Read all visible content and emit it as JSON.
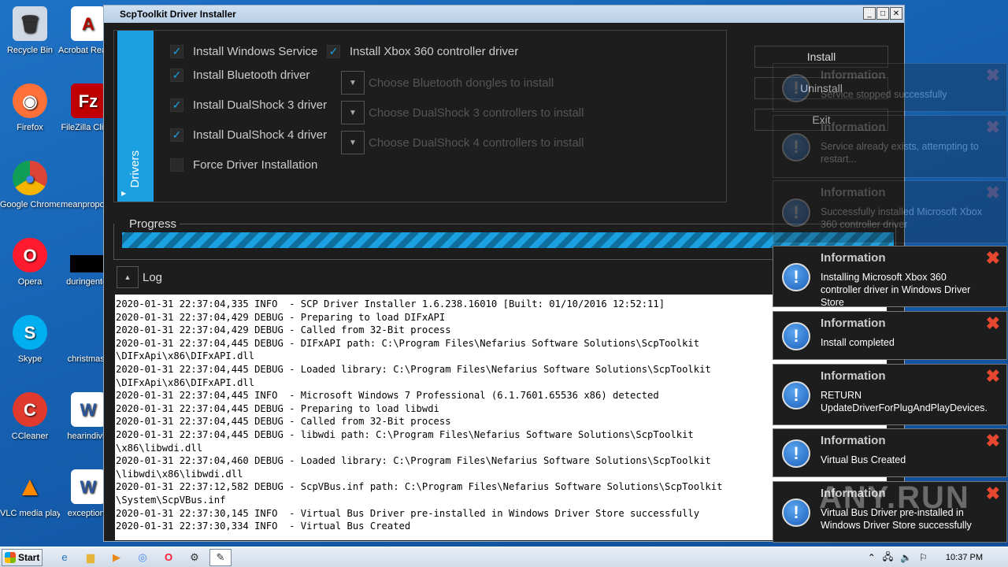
{
  "desktop": {
    "icons": [
      {
        "label": "Recycle Bin",
        "glyph": "🗑",
        "bg": "#cfd8e3"
      },
      {
        "label": "Acrobat Reader DC",
        "glyph": "A",
        "bg": "#b30b00"
      },
      {
        "label": "Firefox",
        "glyph": "◉",
        "bg": "#ff7139"
      },
      {
        "label": "FileZilla Client",
        "glyph": "Fz",
        "bg": "#bf0000"
      },
      {
        "label": "Google Chrome",
        "glyph": "◎",
        "bg": "#4285f4"
      },
      {
        "label": "meanproposal",
        "glyph": "",
        "bg": "#1560b0"
      },
      {
        "label": "Opera",
        "glyph": "O",
        "bg": "#ff1b2d"
      },
      {
        "label": "duringenter",
        "glyph": "",
        "bg": "#000000"
      },
      {
        "label": "Skype",
        "glyph": "S",
        "bg": "#00aff0"
      },
      {
        "label": "christmasc",
        "glyph": "",
        "bg": "#1560b0"
      },
      {
        "label": "CCleaner",
        "glyph": "C",
        "bg": "#e03a2f"
      },
      {
        "label": "hearindivid",
        "glyph": "W",
        "bg": "#2b579a"
      },
      {
        "label": "VLC media player",
        "glyph": "▲",
        "bg": "#ff8800"
      },
      {
        "label": "exceptionc",
        "glyph": "W",
        "bg": "#2b579a"
      }
    ]
  },
  "window": {
    "title": "ScpToolkit Driver Installer",
    "buttons": {
      "minimize": "_",
      "maximize": "□",
      "close": "✕"
    },
    "drivers_tab_label": "Drivers",
    "checkboxes": [
      {
        "label": "Install Windows Service",
        "checked": true
      },
      {
        "label": "Install Xbox 360 controller driver",
        "checked": true
      },
      {
        "label": "Install Bluetooth driver",
        "checked": true
      },
      {
        "label": "Install DualShock 3 driver",
        "checked": true
      },
      {
        "label": "Install DualShock 4 driver",
        "checked": true
      },
      {
        "label": "Force Driver Installation",
        "checked": false
      }
    ],
    "dropdowns": [
      {
        "placeholder": "Choose Bluetooth dongles to install"
      },
      {
        "placeholder": "Choose DualShock 3 controllers to install"
      },
      {
        "placeholder": "Choose DualShock 4 controllers to install"
      }
    ],
    "side_buttons": {
      "install": "Install",
      "uninstall": "Uninstall",
      "exit": "Exit"
    },
    "progress": {
      "label": "Progress",
      "value_percent": 100
    },
    "log": {
      "label": "Log",
      "lines": [
        "2020-01-31 22:37:04,335 INFO  - SCP Driver Installer 1.6.238.16010 [Built: 01/10/2016 12:52:11]",
        "2020-01-31 22:37:04,429 DEBUG - Preparing to load DIFxAPI",
        "2020-01-31 22:37:04,429 DEBUG - Called from 32-Bit process",
        "2020-01-31 22:37:04,445 DEBUG - DIFxAPI path: C:\\Program Files\\Nefarius Software Solutions\\ScpToolkit",
        "\\DIFxApi\\x86\\DIFxAPI.dll",
        "2020-01-31 22:37:04,445 DEBUG - Loaded library: C:\\Program Files\\Nefarius Software Solutions\\ScpToolkit",
        "\\DIFxApi\\x86\\DIFxAPI.dll",
        "2020-01-31 22:37:04,445 INFO  - Microsoft Windows 7 Professional (6.1.7601.65536 x86) detected",
        "2020-01-31 22:37:04,445 DEBUG - Preparing to load libwdi",
        "2020-01-31 22:37:04,445 DEBUG - Called from 32-Bit process",
        "2020-01-31 22:37:04,445 DEBUG - libwdi path: C:\\Program Files\\Nefarius Software Solutions\\ScpToolkit",
        "\\x86\\libwdi.dll",
        "2020-01-31 22:37:04,460 DEBUG - Loaded library: C:\\Program Files\\Nefarius Software Solutions\\ScpToolkit",
        "\\libwdi\\x86\\libwdi.dll",
        "2020-01-31 22:37:12,582 DEBUG - ScpVBus.inf path: C:\\Program Files\\Nefarius Software Solutions\\ScpToolkit",
        "\\System\\ScpVBus.inf",
        "2020-01-31 22:37:30,145 INFO  - Virtual Bus Driver pre-installed in Windows Driver Store successfully",
        "2020-01-31 22:37:30,334 INFO  - Virtual Bus Created"
      ]
    }
  },
  "notifications": [
    {
      "title": "Information",
      "message": "Service stopped successfully",
      "faded": true
    },
    {
      "title": "Information",
      "message": "Service already exists, attempting to restart...",
      "faded": true
    },
    {
      "title": "Information",
      "message": "Successfully installed Microsoft Xbox 360 controller driver",
      "faded": true
    },
    {
      "title": "Information",
      "message": "Installing Microsoft Xbox 360 controller driver in Windows Driver Store",
      "faded": false
    },
    {
      "title": "Information",
      "message": "Install completed",
      "faded": false
    },
    {
      "title": "Information",
      "message": "RETURN UpdateDriverForPlugAndPlayDevices.",
      "faded": false
    },
    {
      "title": "Information",
      "message": "Virtual Bus Created",
      "faded": false
    },
    {
      "title": "Information",
      "message": "Virtual Bus Driver pre-installed in Windows Driver Store successfully",
      "faded": false
    }
  ],
  "taskbar": {
    "start_label": "Start",
    "clock": "10:37 PM",
    "apps": [
      "ie-icon",
      "explorer-icon",
      "media-player-icon",
      "chrome-icon",
      "opera-icon",
      "scptoolkit-icon",
      "installer-icon"
    ]
  },
  "colors": {
    "accent": "#1ba1e2",
    "close_red": "#e6482f"
  },
  "watermark": "ANY.RUN"
}
